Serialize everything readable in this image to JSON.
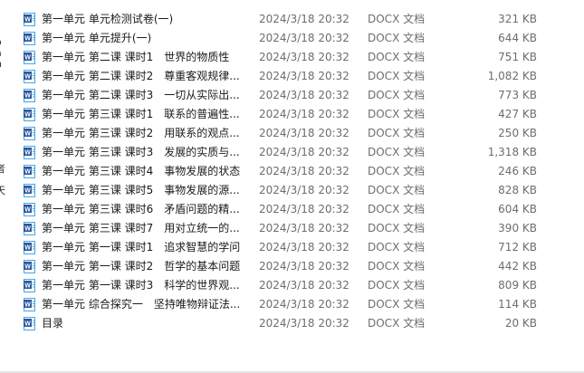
{
  "left_edge_fragments": [
    "o",
    "a",
    "n",
    "者",
    "天"
  ],
  "files": [
    {
      "name": "第一单元 单元检测试卷(一)",
      "date": "2024/3/18 20:32",
      "type": "DOCX 文档",
      "size": "321 KB",
      "icon": "word-doc-icon"
    },
    {
      "name": "第一单元 单元提升(一)",
      "date": "2024/3/18 20:32",
      "type": "DOCX 文档",
      "size": "644 KB",
      "icon": "word-doc-icon"
    },
    {
      "name": "第一单元 第二课 课时1　世界的物质性",
      "date": "2024/3/18 20:32",
      "type": "DOCX 文档",
      "size": "751 KB",
      "icon": "word-doc-icon"
    },
    {
      "name": "第一单元 第二课 课时2　尊重客观规律...",
      "date": "2024/3/18 20:32",
      "type": "DOCX 文档",
      "size": "1,082 KB",
      "icon": "word-doc-icon"
    },
    {
      "name": "第一单元 第二课 课时3　一切从实际出...",
      "date": "2024/3/18 20:32",
      "type": "DOCX 文档",
      "size": "773 KB",
      "icon": "word-doc-icon"
    },
    {
      "name": "第一单元 第三课 课时1　联系的普遍性...",
      "date": "2024/3/18 20:32",
      "type": "DOCX 文档",
      "size": "427 KB",
      "icon": "word-doc-icon"
    },
    {
      "name": "第一单元 第三课 课时2　用联系的观点...",
      "date": "2024/3/18 20:32",
      "type": "DOCX 文档",
      "size": "250 KB",
      "icon": "word-doc-icon"
    },
    {
      "name": "第一单元 第三课 课时3　发展的实质与...",
      "date": "2024/3/18 20:32",
      "type": "DOCX 文档",
      "size": "1,318 KB",
      "icon": "word-doc-icon"
    },
    {
      "name": "第一单元 第三课 课时4　事物发展的状态",
      "date": "2024/3/18 20:32",
      "type": "DOCX 文档",
      "size": "246 KB",
      "icon": "word-doc-icon"
    },
    {
      "name": "第一单元 第三课 课时5　事物发展的源...",
      "date": "2024/3/18 20:32",
      "type": "DOCX 文档",
      "size": "828 KB",
      "icon": "word-doc-icon"
    },
    {
      "name": "第一单元 第三课 课时6　矛盾问题的精...",
      "date": "2024/3/18 20:32",
      "type": "DOCX 文档",
      "size": "604 KB",
      "icon": "word-doc-icon"
    },
    {
      "name": "第一单元 第三课 课时7　用对立统一的...",
      "date": "2024/3/18 20:32",
      "type": "DOCX 文档",
      "size": "390 KB",
      "icon": "word-doc-icon"
    },
    {
      "name": "第一单元 第一课 课时1　追求智慧的学问",
      "date": "2024/3/18 20:32",
      "type": "DOCX 文档",
      "size": "712 KB",
      "icon": "word-doc-icon"
    },
    {
      "name": "第一单元 第一课 课时2　哲学的基本问题",
      "date": "2024/3/18 20:32",
      "type": "DOCX 文档",
      "size": "442 KB",
      "icon": "word-doc-icon"
    },
    {
      "name": "第一单元 第一课 课时3　科学的世界观...",
      "date": "2024/3/18 20:32",
      "type": "DOCX 文档",
      "size": "809 KB",
      "icon": "word-doc-icon"
    },
    {
      "name": "第一单元 综合探究一　坚持唯物辩证法...",
      "date": "2024/3/18 20:32",
      "type": "DOCX 文档",
      "size": "114 KB",
      "icon": "word-doc-icon"
    },
    {
      "name": "目录",
      "date": "2024/3/18 20:32",
      "type": "DOCX 文档",
      "size": "20 KB",
      "icon": "word-doc-icon"
    }
  ],
  "colors": {
    "word_icon_blue": "#2b579a",
    "word_icon_light": "#41a5ee",
    "meta_text": "#6d6d6d",
    "hover": "#e5f3ff"
  }
}
